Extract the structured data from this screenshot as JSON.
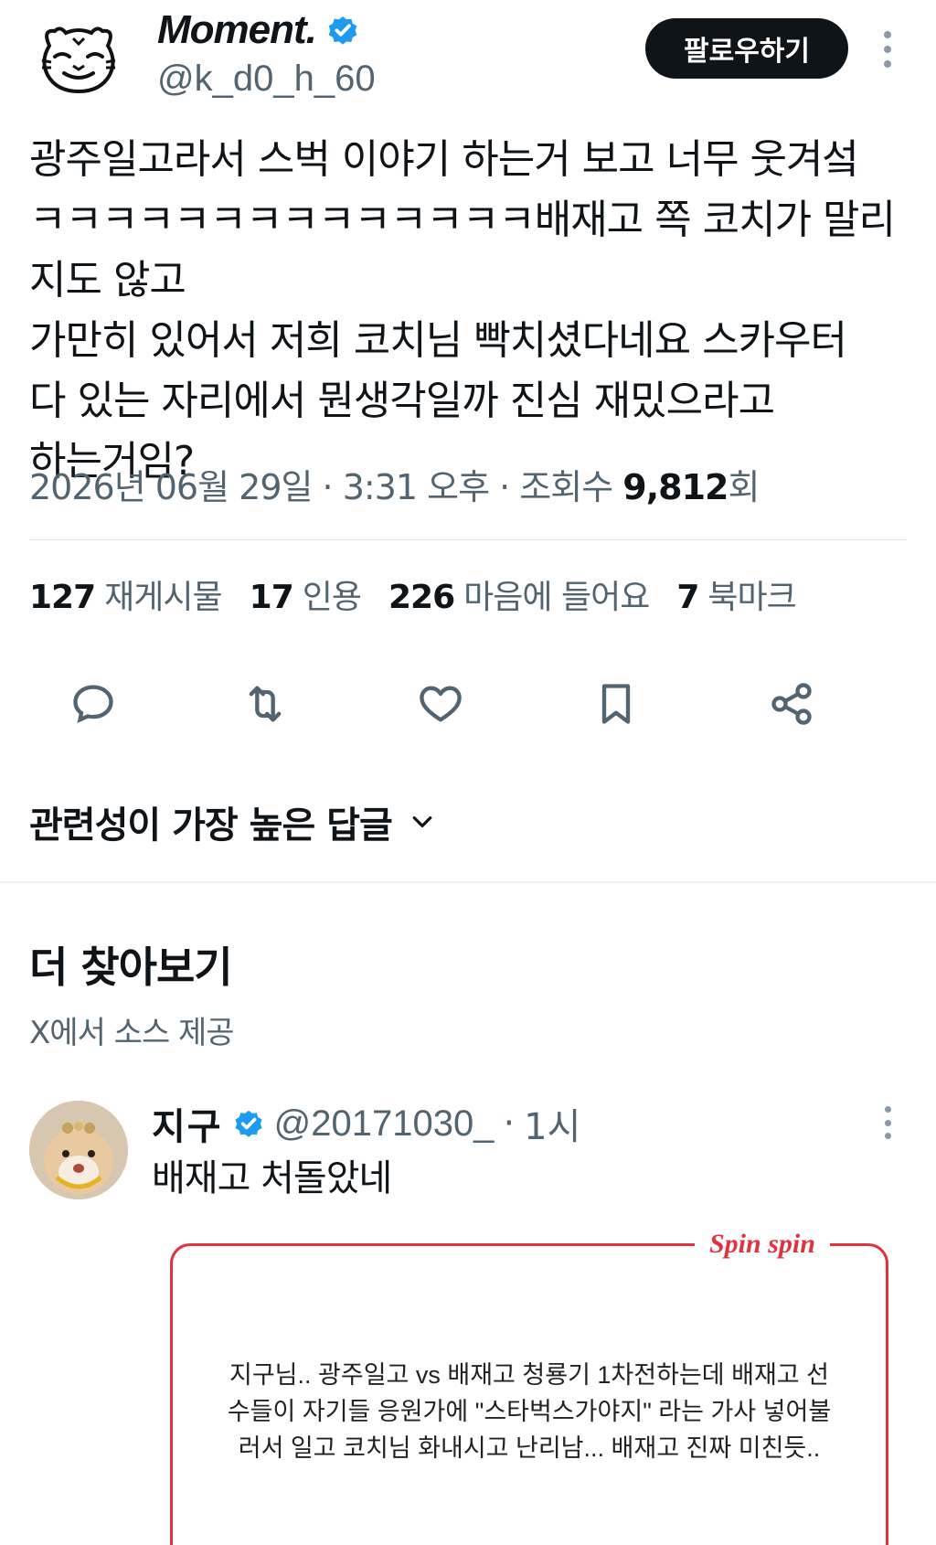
{
  "author": {
    "display_name": "Moment.",
    "handle": "@k_d0_h_60",
    "avatar_icon": "tiger-face-icon",
    "verified_icon": "verified-badge-icon",
    "verified_color": "#1d9bf0"
  },
  "header": {
    "follow_label": "팔로우하기",
    "more_icon": "more-vertical-icon"
  },
  "tweet": {
    "text": "광주일고라서 스벅 이야기 하는거 보고 너무 웃겨섴\nㅋㅋㅋㅋㅋㅋㅋㅋㅋㅋㅋㅋㅋㅋ배재고 쪽 코치가 말리지도 않고\n가만히 있어서 저희 코치님 빡치셨다네요 스카우터\n다 있는 자리에서 뭔생각일까 진심 재밌으라고\n하는거임?",
    "date": "2026년 06월 29일",
    "sep1": " · ",
    "time": "3:31 오후",
    "sep2": " · ",
    "views_label": "조회수 ",
    "views_value": "9,812",
    "views_suffix": "회"
  },
  "stats": [
    {
      "value": "127",
      "label": "재게시물"
    },
    {
      "value": "17",
      "label": "인용"
    },
    {
      "value": "226",
      "label": "마음에 들어요"
    },
    {
      "value": "7",
      "label": "북마크"
    }
  ],
  "actions": [
    {
      "icon": "reply-icon"
    },
    {
      "icon": "repost-icon"
    },
    {
      "icon": "like-icon"
    },
    {
      "icon": "bookmark-icon"
    },
    {
      "icon": "share-icon"
    }
  ],
  "sort": {
    "label": "관련성이 가장 높은 답글",
    "icon": "chevron-down-icon"
  },
  "discover": {
    "title": "더 찾아보기",
    "subtitle": "X에서 소스 제공"
  },
  "reply": {
    "name": "지구",
    "handle": "@20171030_",
    "dot": "·",
    "time": "1시",
    "text": "배재고 처돌았네",
    "avatar_icon": "hamster-avatar-icon"
  },
  "card": {
    "brand": "Spin spin",
    "text": "지구님.. 광주일고 vs 배재고 청룡기 1차전하는데 배재고 선\n수들이 자기들 응원가에 \"스타벅스가야지\" 라는 가사 넣어불\n러서 일고 코치님 화내시고 난리남... 배재고 진짜 미친듯..",
    "accent_color": "#e0333f"
  }
}
